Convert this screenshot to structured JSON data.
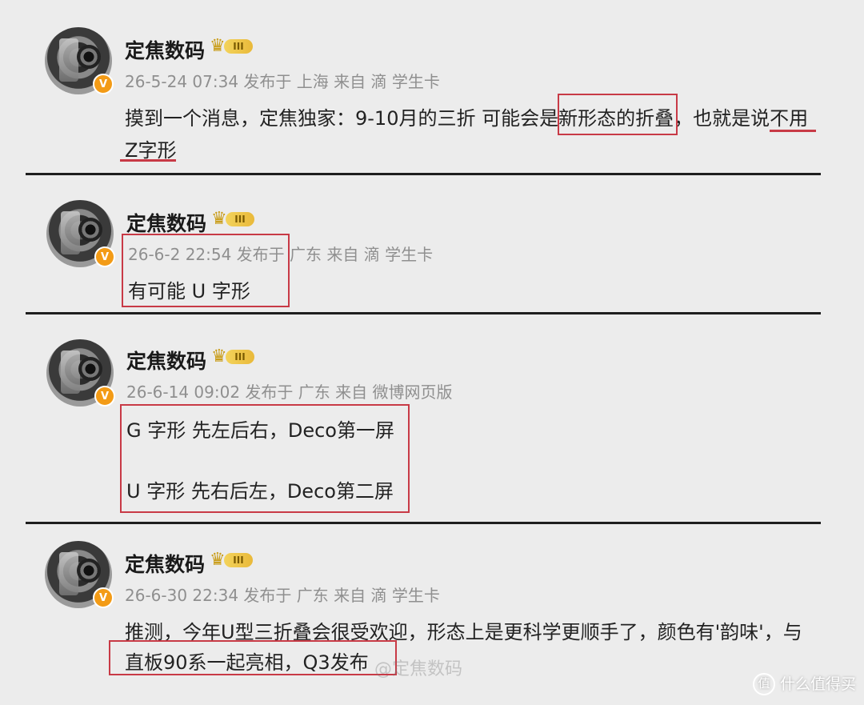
{
  "posts": [
    {
      "name": "定焦数码",
      "level": "III",
      "meta": "26-5-24 07:34 发布于 上海 来自 滴 学生卡",
      "line1": "摸到一个消息，定焦独家：9-10月的三折 可能会是新形态的折叠，也就是说不用",
      "line2": "Z字形"
    },
    {
      "name": "定焦数码",
      "level": "III",
      "meta": "26-6-2 22:54 发布于 广东 来自 滴 学生卡",
      "line1": "有可能 U 字形"
    },
    {
      "name": "定焦数码",
      "level": "III",
      "meta": "26-6-14 09:02 发布于 广东 来自 微博网页版",
      "line1": "G 字形 先左后右，Deco第一屏",
      "line2": "U 字形 先右后左，Deco第二屏"
    },
    {
      "name": "定焦数码",
      "level": "III",
      "meta": "26-6-30 22:34 发布于 广东 来自 滴 学生卡",
      "line1": "推测，今年U型三折叠会很受欢迎，形态上是更科学更顺手了，颜色有'韵味'，与",
      "line2": "直板90系一起亮相，Q3发布"
    }
  ],
  "watermark": "@定焦数码",
  "brand": {
    "icon": "值",
    "text": "什么值得买"
  },
  "colors": {
    "highlight": "#c83a46",
    "vip_badge": "#f39b16"
  }
}
